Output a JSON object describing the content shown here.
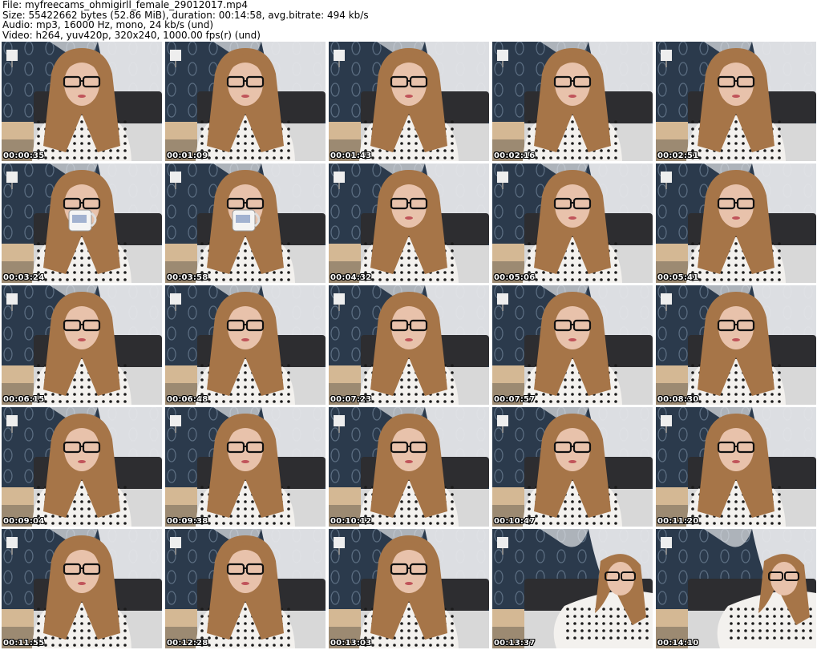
{
  "header": {
    "file_line": "File: myfreecams_ohmigirll_female_29012017.mp4",
    "size_line": "Size: 55422662 bytes (52.86 MiB), duration: 00:14:58, avg.bitrate: 494 kb/s",
    "audio_line": "Audio: mp3, 16000 Hz, mono, 24 kb/s (und)",
    "video_line": "Video: h264, yuv420p, 320x240, 1000.00 fps(r) (und)"
  },
  "grid": {
    "columns": 5,
    "rows": 5
  },
  "thumbnails": [
    {
      "timestamp": "00:00:35",
      "variant": "normal"
    },
    {
      "timestamp": "00:01:09",
      "variant": "normal"
    },
    {
      "timestamp": "00:01:43",
      "variant": "normal"
    },
    {
      "timestamp": "00:02:16",
      "variant": "normal"
    },
    {
      "timestamp": "00:02:51",
      "variant": "normal"
    },
    {
      "timestamp": "00:03:24",
      "variant": "mug"
    },
    {
      "timestamp": "00:03:58",
      "variant": "mug"
    },
    {
      "timestamp": "00:04:32",
      "variant": "normal"
    },
    {
      "timestamp": "00:05:06",
      "variant": "normal"
    },
    {
      "timestamp": "00:05:41",
      "variant": "normal"
    },
    {
      "timestamp": "00:06:15",
      "variant": "normal"
    },
    {
      "timestamp": "00:06:48",
      "variant": "normal"
    },
    {
      "timestamp": "00:07:23",
      "variant": "normal"
    },
    {
      "timestamp": "00:07:57",
      "variant": "normal"
    },
    {
      "timestamp": "00:08:30",
      "variant": "normal"
    },
    {
      "timestamp": "00:09:04",
      "variant": "normal"
    },
    {
      "timestamp": "00:09:38",
      "variant": "normal"
    },
    {
      "timestamp": "00:10:12",
      "variant": "normal"
    },
    {
      "timestamp": "00:10:47",
      "variant": "normal"
    },
    {
      "timestamp": "00:11:20",
      "variant": "normal"
    },
    {
      "timestamp": "00:11:55",
      "variant": "normal"
    },
    {
      "timestamp": "00:12:28",
      "variant": "normal"
    },
    {
      "timestamp": "00:13:03",
      "variant": "normal"
    },
    {
      "timestamp": "00:13:37",
      "variant": "lying"
    },
    {
      "timestamp": "00:14:10",
      "variant": "lying"
    }
  ],
  "colors": {
    "wallpaper": "#2b3a4c",
    "wallpaper_pattern": "#7f93a8",
    "curtain": "#e6e7ea",
    "headboard": "#2d2d30",
    "hair": "#a67548",
    "skin": "#e8c2ab",
    "shirt": "#f3f1ee",
    "dots": "#1c1c1c",
    "nightstand": "#d4b894"
  }
}
